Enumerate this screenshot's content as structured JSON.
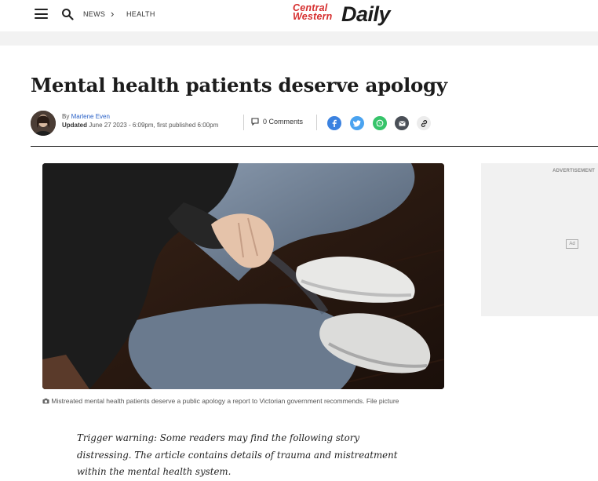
{
  "header": {
    "nav_icon": "hamburger-menu-icon",
    "search_icon": "search-icon",
    "breadcrumb": [
      "NEWS",
      "HEALTH"
    ],
    "breadcrumb_separator": "›",
    "logo_top": "Central",
    "logo_bottom": "Western",
    "logo_main": "Daily",
    "logo_colors": {
      "red": "#d62f2f",
      "dark": "#1c1c1c"
    }
  },
  "article": {
    "title": "Mental health patients deserve apology",
    "byline_prefix": "By",
    "author": "Marlene Even",
    "updated_label": "Updated",
    "updated_text": "June 27 2023 - 6:09pm, first published 6:00pm",
    "comments": "0 Comments",
    "share_icons": [
      "facebook-icon",
      "twitter-icon",
      "whatsapp-icon",
      "email-icon",
      "link-icon"
    ],
    "share_colors": {
      "facebook": "#3b82e0",
      "twitter": "#4aa3f0",
      "whatsapp": "#36c46a",
      "email": "#4a4f57",
      "link": "#ececec"
    },
    "image_caption": "Mistreated mental health patients deserve a public apology a report to Victorian government recommends. File picture",
    "trigger_warning": "Trigger warning: Some readers may find the following story distressing. The article contains details of trauma and mistreatment within the mental health system."
  },
  "ad": {
    "label": "ADVERTISEMENT",
    "badge": "Ad"
  }
}
